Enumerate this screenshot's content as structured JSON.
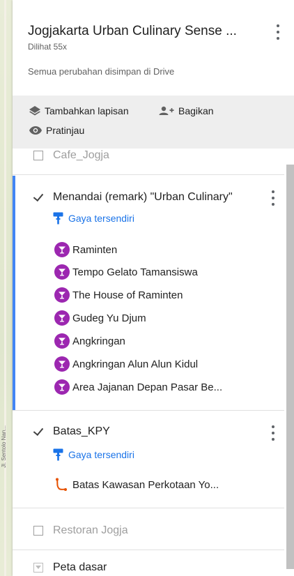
{
  "header": {
    "title": "Jogjakarta Urban Culinary Sense ...",
    "views": "Dilihat 55x",
    "saved_status": "Semua perubahan disimpan di Drive"
  },
  "toolbar": {
    "add_layer": "Tambahkan lapisan",
    "share": "Bagikan",
    "preview": "Pratinjau"
  },
  "layers": [
    {
      "name": "Cafe_Jogja",
      "checked": false
    },
    {
      "name": "Menandai (remark) \"Urban Culinary\"",
      "checked": true,
      "style_label": "Gaya tersendiri",
      "items": [
        "Raminten",
        "Tempo Gelato Tamansiswa",
        "The House of Raminten",
        "Gudeg Yu Djum",
        "Angkringan",
        "Angkringan Alun Alun Kidul",
        "Area Jajanan Depan Pasar Be..."
      ]
    },
    {
      "name": "Batas_KPY",
      "checked": true,
      "style_label": "Gaya tersendiri",
      "items": [
        "Batas Kawasan Perkotaan Yo..."
      ]
    },
    {
      "name": "Restoran Jogja",
      "checked": false
    }
  ],
  "basemap": {
    "label": "Peta dasar"
  },
  "map": {
    "street_label": "Jl. Sentolo Nan..."
  },
  "colors": {
    "accent": "#1a73e8",
    "active_bar": "#4285f4",
    "pin": "#9c27b0",
    "line_icon": "#e65100"
  }
}
